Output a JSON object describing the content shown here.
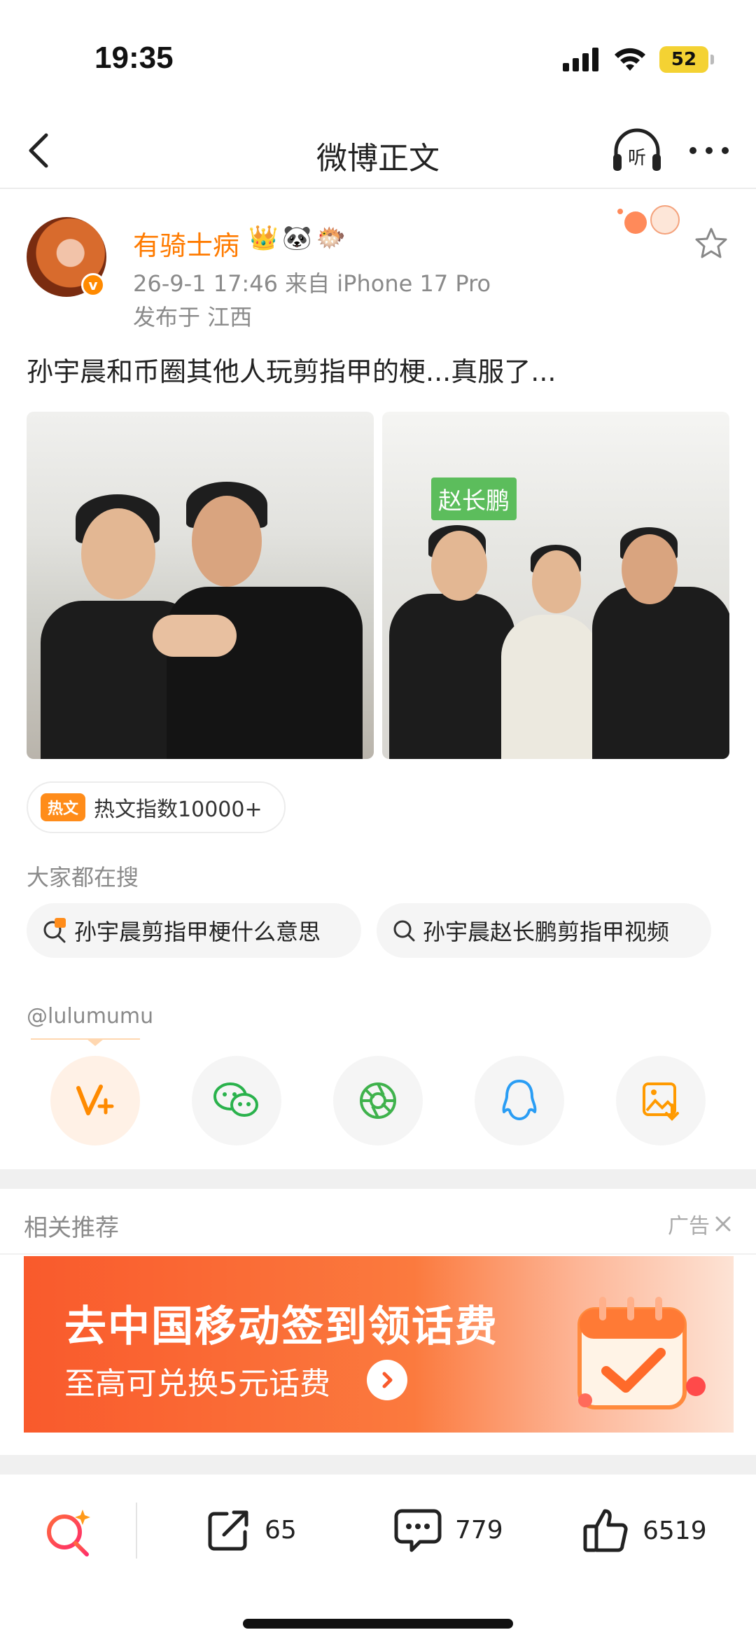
{
  "status_bar": {
    "time": "19:35",
    "battery": "52"
  },
  "nav": {
    "title": "微博正文",
    "listen_label": "听"
  },
  "post": {
    "username": "有骑士病",
    "meta": "26-9-1 17:46  来自 iPhone 17 Pro",
    "location": "发布于 江西",
    "text": "孙宇晨和币圈其他人玩剪指甲的梗...真服了...",
    "photo_tag": "赵长鹏"
  },
  "hot": {
    "tag": "热文",
    "text": "热文指数10000+"
  },
  "search": {
    "title": "大家都在搜",
    "chips": [
      "孙宇晨剪指甲梗什么意思",
      "孙宇晨赵长鹏剪指甲视频"
    ]
  },
  "mention": "@lulumumu",
  "share": [
    "vplus-icon",
    "wechat-icon",
    "moments-icon",
    "qq-icon",
    "save-image-icon"
  ],
  "recommend": {
    "title": "相关推荐",
    "ad_label": "广告",
    "banner_title": "去中国移动签到领话费",
    "banner_sub": "至高可兑换5元话费"
  },
  "bottom_bar": {
    "reposts": "65",
    "comments": "779",
    "likes": "6519"
  },
  "colors": {
    "accent": "#ff7b00",
    "hot": "#ff8c1a",
    "banner": "#f95a2c"
  }
}
